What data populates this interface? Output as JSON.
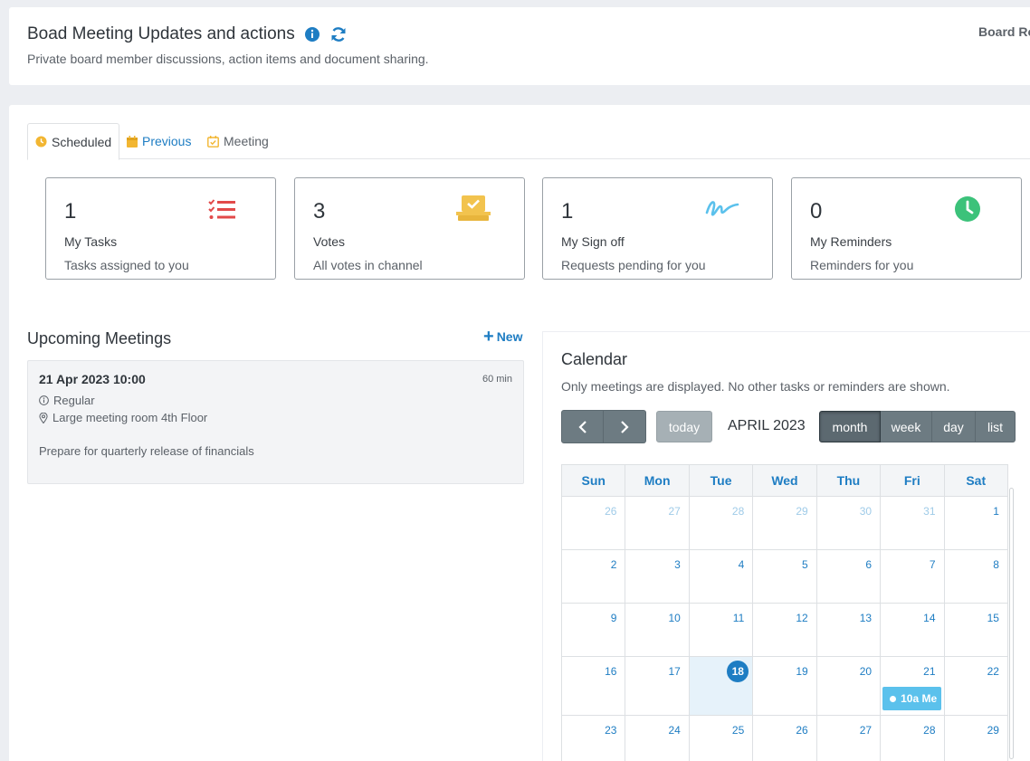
{
  "header": {
    "title": "Boad Meeting Updates and actions",
    "subtitle": "Private board member discussions, action items and document sharing.",
    "crumb": "Board Ro"
  },
  "tabs": [
    {
      "label": "Scheduled",
      "icon": "clock-icon"
    },
    {
      "label": "Previous",
      "icon": "calendar-icon"
    },
    {
      "label": "Meeting",
      "icon": "calendar-check-icon"
    }
  ],
  "cards": [
    {
      "count": "1",
      "label": "My Tasks",
      "sub": "Tasks assigned to you",
      "icon": "task-list-icon",
      "color": "#e24a4a"
    },
    {
      "count": "3",
      "label": "Votes",
      "sub": "All votes in channel",
      "icon": "vote-box-icon",
      "color": "#f2c34e"
    },
    {
      "count": "1",
      "label": "My Sign off",
      "sub": "Requests pending for you",
      "icon": "signature-icon",
      "color": "#5bc1ec"
    },
    {
      "count": "0",
      "label": "My Reminders",
      "sub": "Reminders for you",
      "icon": "clock-icon",
      "color": "#3cc27a"
    }
  ],
  "upcoming": {
    "title": "Upcoming Meetings",
    "new_label": "New",
    "meetings": [
      {
        "datetime": "21 Apr 2023 10:00",
        "duration": "60 min",
        "type": "Regular",
        "location": "Large meeting room 4th Floor",
        "description": "Prepare for quarterly release of financials"
      }
    ]
  },
  "calendar": {
    "title": "Calendar",
    "note": "Only meetings are displayed. No other tasks or reminders are shown.",
    "today_label": "today",
    "month_label": "APRIL 2023",
    "views": [
      "month",
      "week",
      "day",
      "list"
    ],
    "active_view": "month",
    "days": [
      "Sun",
      "Mon",
      "Tue",
      "Wed",
      "Thu",
      "Fri",
      "Sat"
    ],
    "weeks": [
      [
        "26",
        "27",
        "28",
        "29",
        "30",
        "31",
        "1"
      ],
      [
        "2",
        "3",
        "4",
        "5",
        "6",
        "7",
        "8"
      ],
      [
        "9",
        "10",
        "11",
        "12",
        "13",
        "14",
        "15"
      ],
      [
        "16",
        "17",
        "18",
        "19",
        "20",
        "21",
        "22"
      ],
      [
        "23",
        "24",
        "25",
        "26",
        "27",
        "28",
        "29"
      ]
    ],
    "today_date": "18",
    "event": {
      "date": "21",
      "label": "10a Me"
    }
  }
}
